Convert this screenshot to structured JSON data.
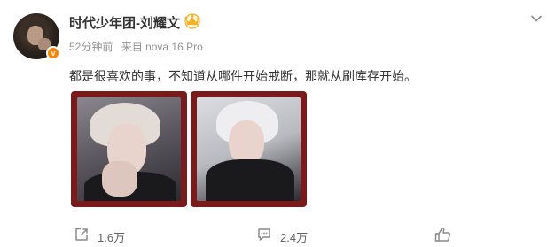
{
  "post": {
    "author": "时代少年团-刘耀文",
    "verified_badge": "v",
    "time": "52分钟前",
    "source_prefix": "来自",
    "source": "nova 16 Pro",
    "content": "都是很喜欢的事，不知道从哪件开始戒断，那就从刷库存开始。",
    "images": [
      {
        "name": "photo-1"
      },
      {
        "name": "photo-2"
      }
    ]
  },
  "actions": {
    "repost_count": "1.6万",
    "comment_count": "2.4万"
  },
  "icons": {
    "crown": "crown-icon",
    "menu": "chevron-down-icon",
    "repost": "repost-icon",
    "comment": "comment-icon",
    "like": "like-icon"
  },
  "colors": {
    "verified": "#ff8200",
    "crown": "#f5b026",
    "meta_text": "#939393",
    "image_frame": "#7a1a1a"
  }
}
